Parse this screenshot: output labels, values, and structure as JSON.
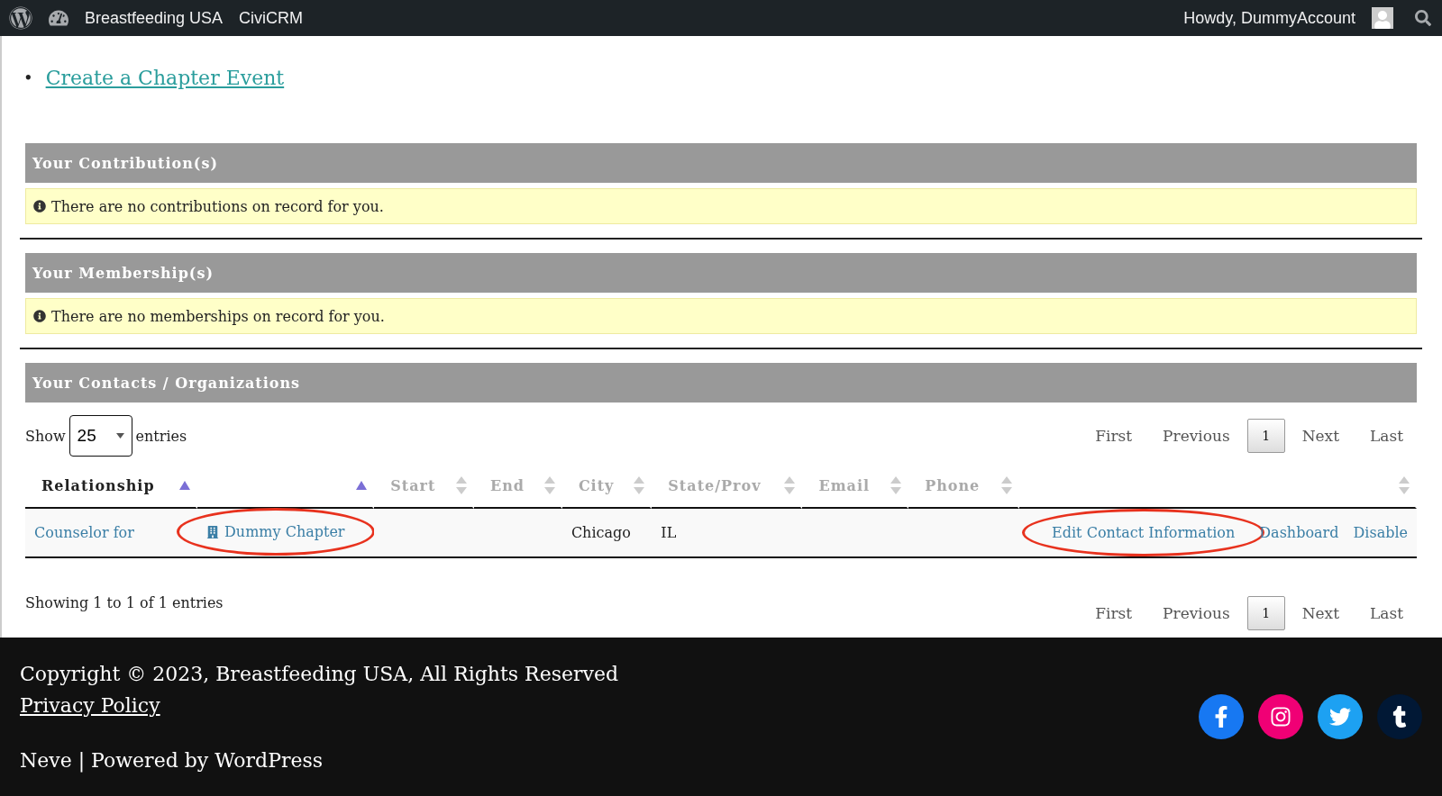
{
  "admin_bar": {
    "site": "Breastfeeding USA",
    "menu": "CiviCRM",
    "greeting": "Howdy, DummyAccount"
  },
  "links": [
    {
      "marker": "•",
      "label": "Create a Chapter Event"
    }
  ],
  "sections": [
    {
      "title": "Your Contribution(s)",
      "notice": "There are no contributions on record for you."
    },
    {
      "title": "Your Membership(s)",
      "notice": "There are no memberships on record for you."
    },
    {
      "title": "Your Contacts / Organizations"
    }
  ],
  "table": {
    "length_label_before": "Show",
    "length_value": "25",
    "length_label_after": "entries",
    "pagination": [
      {
        "label": "First",
        "selected": false
      },
      {
        "label": "Previous",
        "selected": false
      },
      {
        "label": "1",
        "selected": true
      },
      {
        "label": "Next",
        "selected": false
      },
      {
        "label": "Last",
        "selected": false
      }
    ],
    "columns": [
      {
        "label": "Relationship",
        "sorted": true
      },
      {
        "sorted": true
      },
      {
        "label": "Start",
        "sorted": false
      },
      {
        "label": "End",
        "sorted": false
      },
      {
        "label": "City",
        "sorted": false
      },
      {
        "label": "State/Prov",
        "sorted": false
      },
      {
        "label": "Email",
        "sorted": false
      },
      {
        "label": "Phone",
        "sorted": false
      },
      {
        "sorted": false
      }
    ],
    "rows": [
      {
        "relationship": "Counselor for",
        "contact": "Dummy Chapter",
        "contact_highlighted": true,
        "city": "Chicago",
        "state": "IL",
        "actions": [
          {
            "label": "Edit Contact Information",
            "highlighted": true
          },
          {
            "label": "Dashboard",
            "highlighted": false
          },
          {
            "label": "Disable",
            "highlighted": false
          }
        ]
      }
    ],
    "info": "Showing 1 to 1 of 1 entries",
    "bottom_pagination": [
      {
        "label": "First",
        "selected": false
      },
      {
        "label": "Previous",
        "selected": false
      },
      {
        "label": "1",
        "selected": true
      },
      {
        "label": "Next",
        "selected": false
      },
      {
        "label": "Last",
        "selected": false
      }
    ]
  },
  "footer": {
    "copyright": "Copyright © 2023, Breastfeeding USA, All Rights Reserved",
    "privacy": "Privacy Policy",
    "credit": "Neve | Powered by WordPress",
    "social": [
      {
        "kind": "facebook",
        "color": "#1778f2"
      },
      {
        "kind": "instagram",
        "color": "#f00075"
      },
      {
        "kind": "twitter",
        "color": "#1da1f2"
      },
      {
        "kind": "tumblr",
        "color": "#011835"
      }
    ]
  }
}
